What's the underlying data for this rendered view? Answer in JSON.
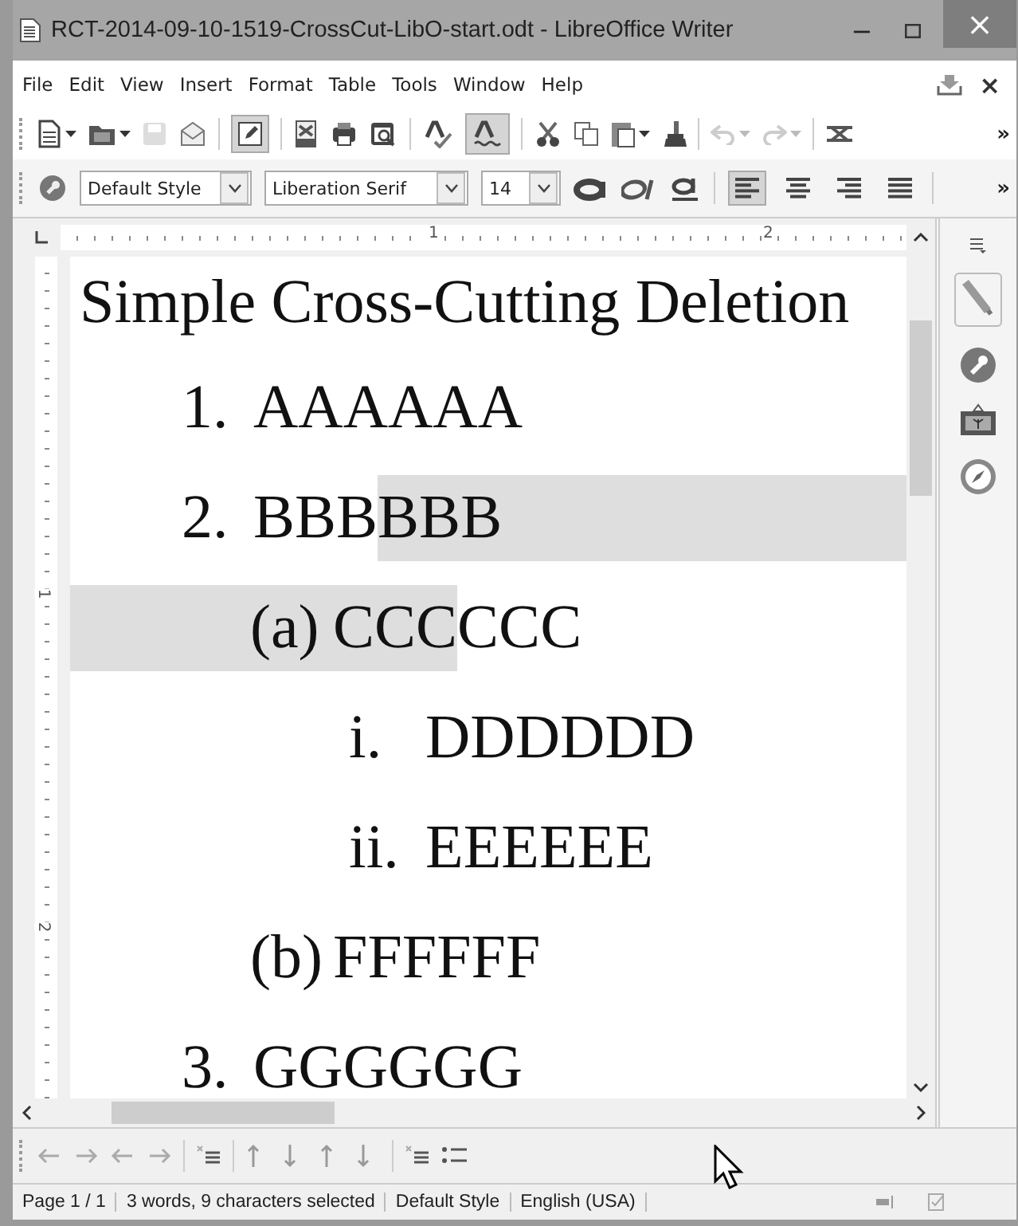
{
  "window": {
    "title": "RCT-2014-09-10-1519-CrossCut-LibO-start.odt - LibreOffice Writer",
    "minimize": "−",
    "close": "×"
  },
  "menu": [
    {
      "label": "File"
    },
    {
      "label": "Edit"
    },
    {
      "label": "View"
    },
    {
      "label": "Insert"
    },
    {
      "label": "Format"
    },
    {
      "label": "Table"
    },
    {
      "label": "Tools"
    },
    {
      "label": "Window"
    },
    {
      "label": "Help"
    }
  ],
  "menu_close": "×",
  "toolbar": {
    "save_disabled": true,
    "edit_mode_on": true,
    "auto_spellcheck_on": true,
    "undo_disabled": true,
    "redo_disabled": true,
    "more": "»"
  },
  "formatting": {
    "paragraph_style": "Default Style",
    "font_name": "Liberation Serif",
    "font_size": "14",
    "align_buttons": [
      {
        "kind": "left",
        "selected": true
      },
      {
        "kind": "center",
        "selected": false
      },
      {
        "kind": "right",
        "selected": false
      },
      {
        "kind": "justify",
        "selected": false
      }
    ],
    "more": "»"
  },
  "ruler": {
    "labels": [
      "1",
      "2"
    ]
  },
  "vertical_ruler": {
    "labels": [
      "1",
      "2"
    ]
  },
  "document": {
    "heading": "Simple Cross-Cutting Deletion",
    "items": [
      {
        "label": "1.",
        "label_selected": false,
        "segments": [
          {
            "text": "AAAAAA",
            "selected": false
          }
        ]
      },
      {
        "label": "2.",
        "label_selected": false,
        "segments": [
          {
            "text": "BBB",
            "selected": false
          },
          {
            "text": "BBB",
            "selected": true
          }
        ],
        "children": [
          {
            "label": "(a)",
            "label_selected": true,
            "segments": [
              {
                "text": "CCC",
                "selected": true
              },
              {
                "text": "CCC",
                "selected": false
              }
            ],
            "children": [
              {
                "label": "i.",
                "label_selected": false,
                "segments": [
                  {
                    "text": "DDDDDD",
                    "selected": false
                  }
                ]
              },
              {
                "label": "ii.",
                "label_selected": false,
                "segments": [
                  {
                    "text": "EEEEEE",
                    "selected": false
                  }
                ]
              }
            ]
          },
          {
            "label": "(b)",
            "label_selected": false,
            "segments": [
              {
                "text": "FFFFFF",
                "selected": false
              }
            ]
          }
        ]
      },
      {
        "label": "3.",
        "label_selected": false,
        "segments": [
          {
            "text": "GGGGGG",
            "selected": false
          }
        ]
      }
    ]
  },
  "status_bar": {
    "page": "Page 1 / 1",
    "selection": "3 words, 9 characters selected",
    "page_style": "Default Style",
    "language": "English (USA)"
  }
}
